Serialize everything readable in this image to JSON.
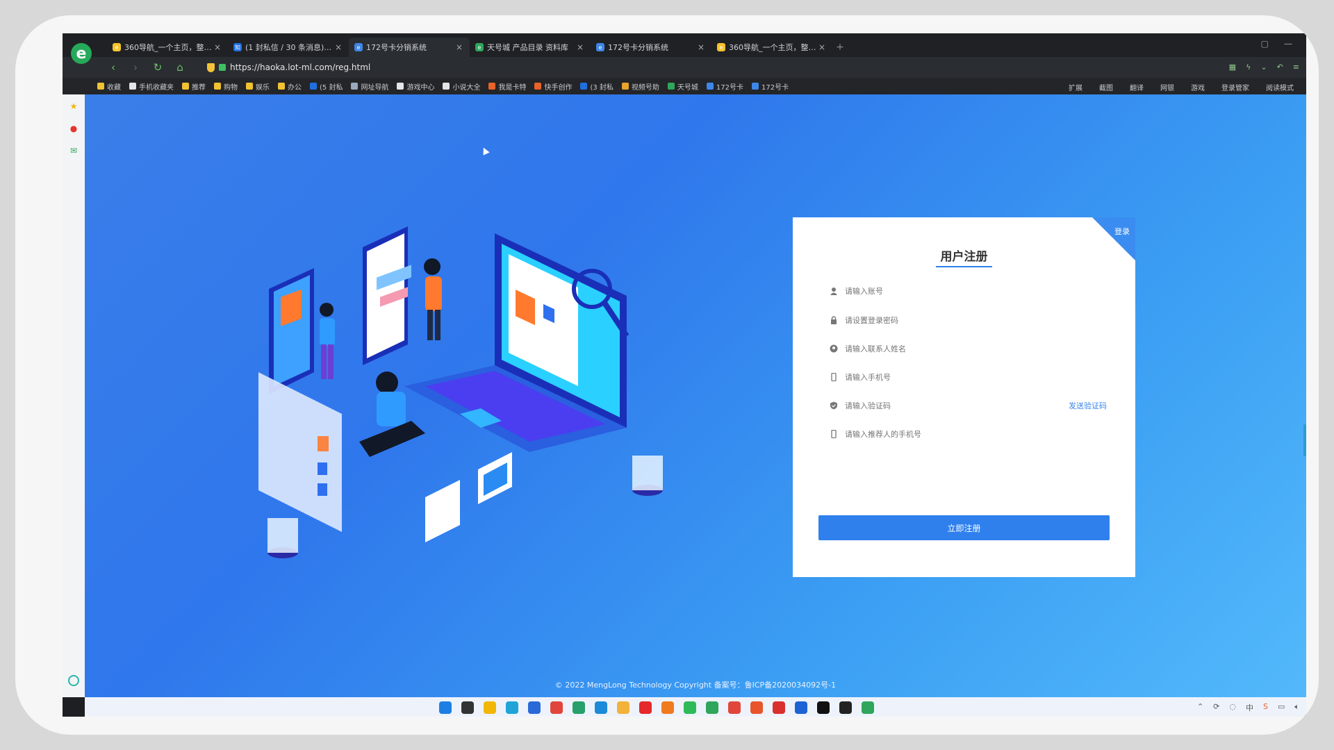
{
  "browser": {
    "tabs": [
      {
        "title": "360导航_一个主页，整个世",
        "fav_color": "#f6c32b",
        "fav_glyph": "e"
      },
      {
        "title": "(1 封私信 / 30 条消息) 首",
        "fav_color": "#1f6fe0",
        "fav_glyph": "知"
      },
      {
        "title": "172号卡分销系统",
        "fav_color": "#3e87e8",
        "fav_glyph": "e",
        "active": true
      },
      {
        "title": "天号城 产品目录 资料库",
        "fav_color": "#2fa65b",
        "fav_glyph": "e"
      },
      {
        "title": "172号卡分销系统",
        "fav_color": "#3e87e8",
        "fav_glyph": "e"
      },
      {
        "title": "360导航_一个主页，整个世",
        "fav_color": "#f6c32b",
        "fav_glyph": "e"
      }
    ],
    "url": "https://haoka.lot-ml.com/reg.html",
    "bookmarks": [
      {
        "label": "收藏",
        "color": "#f1c232"
      },
      {
        "label": "手机收藏夹",
        "color": "#e5e5e5"
      },
      {
        "label": "推荐",
        "color": "#f1c232"
      },
      {
        "label": "购物",
        "color": "#f1c232"
      },
      {
        "label": "娱乐",
        "color": "#f1c232"
      },
      {
        "label": "办公",
        "color": "#f1c232"
      },
      {
        "label": "(5 封私",
        "color": "#1f6fe0"
      },
      {
        "label": "网址导航",
        "color": "#9ab"
      },
      {
        "label": "游戏中心",
        "color": "#e5e5e5"
      },
      {
        "label": "小说大全",
        "color": "#e5e5e5"
      },
      {
        "label": "我是卡特",
        "color": "#e8622a"
      },
      {
        "label": "快手创作",
        "color": "#e8622a"
      },
      {
        "label": "(3 封私",
        "color": "#1f6fe0"
      },
      {
        "label": "视频号助",
        "color": "#e8a52a"
      },
      {
        "label": "天号城",
        "color": "#2fa65b"
      },
      {
        "label": "172号卡",
        "color": "#3e87e8"
      },
      {
        "label": "172号卡",
        "color": "#3e87e8"
      }
    ],
    "bookmarks_right": [
      "扩展",
      "截图",
      "翻译",
      "网银",
      "游戏",
      "登录管家",
      "阅读模式"
    ]
  },
  "register": {
    "corner_label": "登录",
    "title": "用户注册",
    "fields": {
      "account": "请输入账号",
      "password": "请设置登录密码",
      "contact_name": "请输入联系人姓名",
      "phone": "请输入手机号",
      "code": "请输入验证码",
      "referrer": "请输入推荐人的手机号"
    },
    "send_code": "发送验证码",
    "submit": "立即注册"
  },
  "footer": {
    "copyright": "© 2022 MengLong Technology Copyright 备案号：鲁ICP备2020034092号-1"
  },
  "taskbar": {
    "icons": [
      {
        "name": "windows-start-icon",
        "color": "#1d7fe3"
      },
      {
        "name": "search-icon",
        "color": "#333333"
      },
      {
        "name": "file-explorer-icon",
        "color": "#f2b705"
      },
      {
        "name": "edge-icon",
        "color": "#1fa4d8"
      },
      {
        "name": "browser-icon",
        "color": "#2a6ad8"
      },
      {
        "name": "chrome-icon",
        "color": "#e0463a"
      },
      {
        "name": "edge-dev-icon",
        "color": "#27a06b"
      },
      {
        "name": "edge-beta-icon",
        "color": "#1b8ad8"
      },
      {
        "name": "app-icon",
        "color": "#f3b23a"
      },
      {
        "name": "opera-icon",
        "color": "#e42a2a"
      },
      {
        "name": "firefox-icon",
        "color": "#f07a1e"
      },
      {
        "name": "wechat-icon",
        "color": "#2fba5a"
      },
      {
        "name": "360-browser-icon",
        "color": "#2fa65b"
      },
      {
        "name": "chrome-alt-icon",
        "color": "#e0463a"
      },
      {
        "name": "firefox-alt-icon",
        "color": "#e8552a"
      },
      {
        "name": "wps-icon",
        "color": "#d9302e"
      },
      {
        "name": "app-blue-icon",
        "color": "#1f62d6"
      },
      {
        "name": "capcut-icon",
        "color": "#111111"
      },
      {
        "name": "screen-recorder-icon",
        "color": "#222222"
      },
      {
        "name": "remote-desktop-icon",
        "color": "#2fa65b"
      }
    ],
    "tray_ime": "中"
  }
}
